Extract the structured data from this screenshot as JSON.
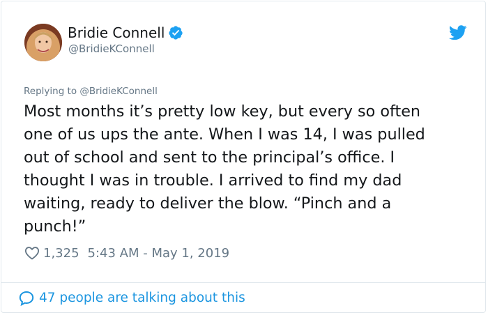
{
  "author": {
    "name": "Bridie Connell",
    "handle": "@BridieKConnell"
  },
  "reply": {
    "prefix": "Replying to ",
    "mention": "@BridieKConnell"
  },
  "tweet": {
    "text": "Most months it’s pretty low key, but every so often\none of us ups the ante. When I was 14, I was pulled\nout of school and sent to the principal’s office. I\nthought I was in trouble. I arrived to find my dad\nwaiting, ready to deliver the blow. “Pinch and a\npunch!”",
    "likes": "1,325",
    "timestamp": "5:43 AM - May 1, 2019"
  },
  "footer": {
    "talking": "47 people are talking about this"
  },
  "colors": {
    "twitter_blue": "#1da1f2",
    "link_blue": "#1b95e0",
    "text": "#14171a",
    "muted": "#657786",
    "border": "#e1e8ed"
  },
  "icons": {
    "verified": "verified-badge-icon",
    "logo": "twitter-bird-icon",
    "like": "heart-outline-icon",
    "conversation": "speech-bubble-icon"
  }
}
